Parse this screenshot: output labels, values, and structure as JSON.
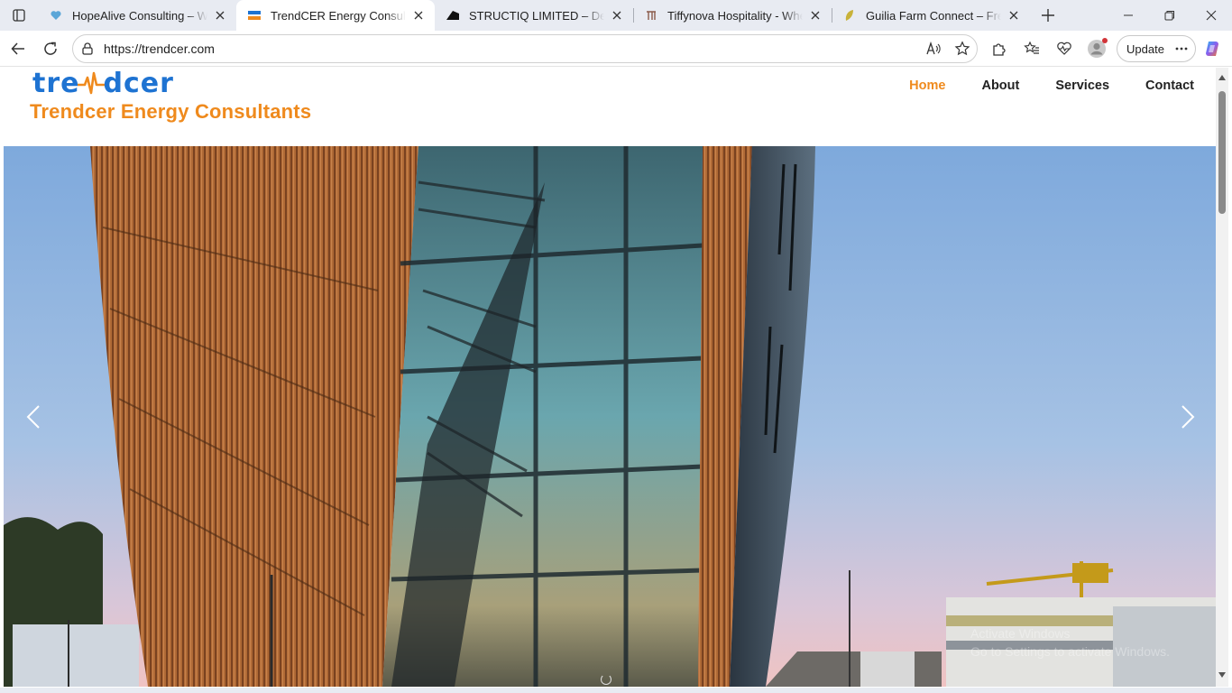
{
  "browser": {
    "tabs": [
      {
        "title": "HopeAlive Consulting – Where",
        "favicon": "heart-globe-icon",
        "active": false
      },
      {
        "title": "TrendCER Energy Consultants",
        "favicon": "trendcer-icon",
        "active": true
      },
      {
        "title": "STRUCTIQ LIMITED – Dedicate",
        "favicon": "structiq-icon",
        "active": false
      },
      {
        "title": "Tiffynova Hospitality - Where",
        "favicon": "tiffynova-icon",
        "active": false
      },
      {
        "title": "Guilia Farm Connect – Fresh fr",
        "favicon": "leaf-icon",
        "active": false
      }
    ],
    "url": "https://trendcer.com",
    "update_label": "Update"
  },
  "site": {
    "logo_word_left": "tre",
    "logo_word_right": "dcer",
    "tagline": "Trendcer Energy Consultants",
    "nav": [
      {
        "label": "Home",
        "active": true
      },
      {
        "label": "About",
        "active": false
      },
      {
        "label": "Services",
        "active": false
      },
      {
        "label": "Contact",
        "active": false
      }
    ]
  },
  "hero": {
    "watermark_line1": "Activate Windows",
    "watermark_line2": "Go to Settings to activate Windows."
  },
  "colors": {
    "brand_blue": "#1e73d2",
    "brand_orange": "#ef8a1d",
    "nav_text": "#222222"
  }
}
